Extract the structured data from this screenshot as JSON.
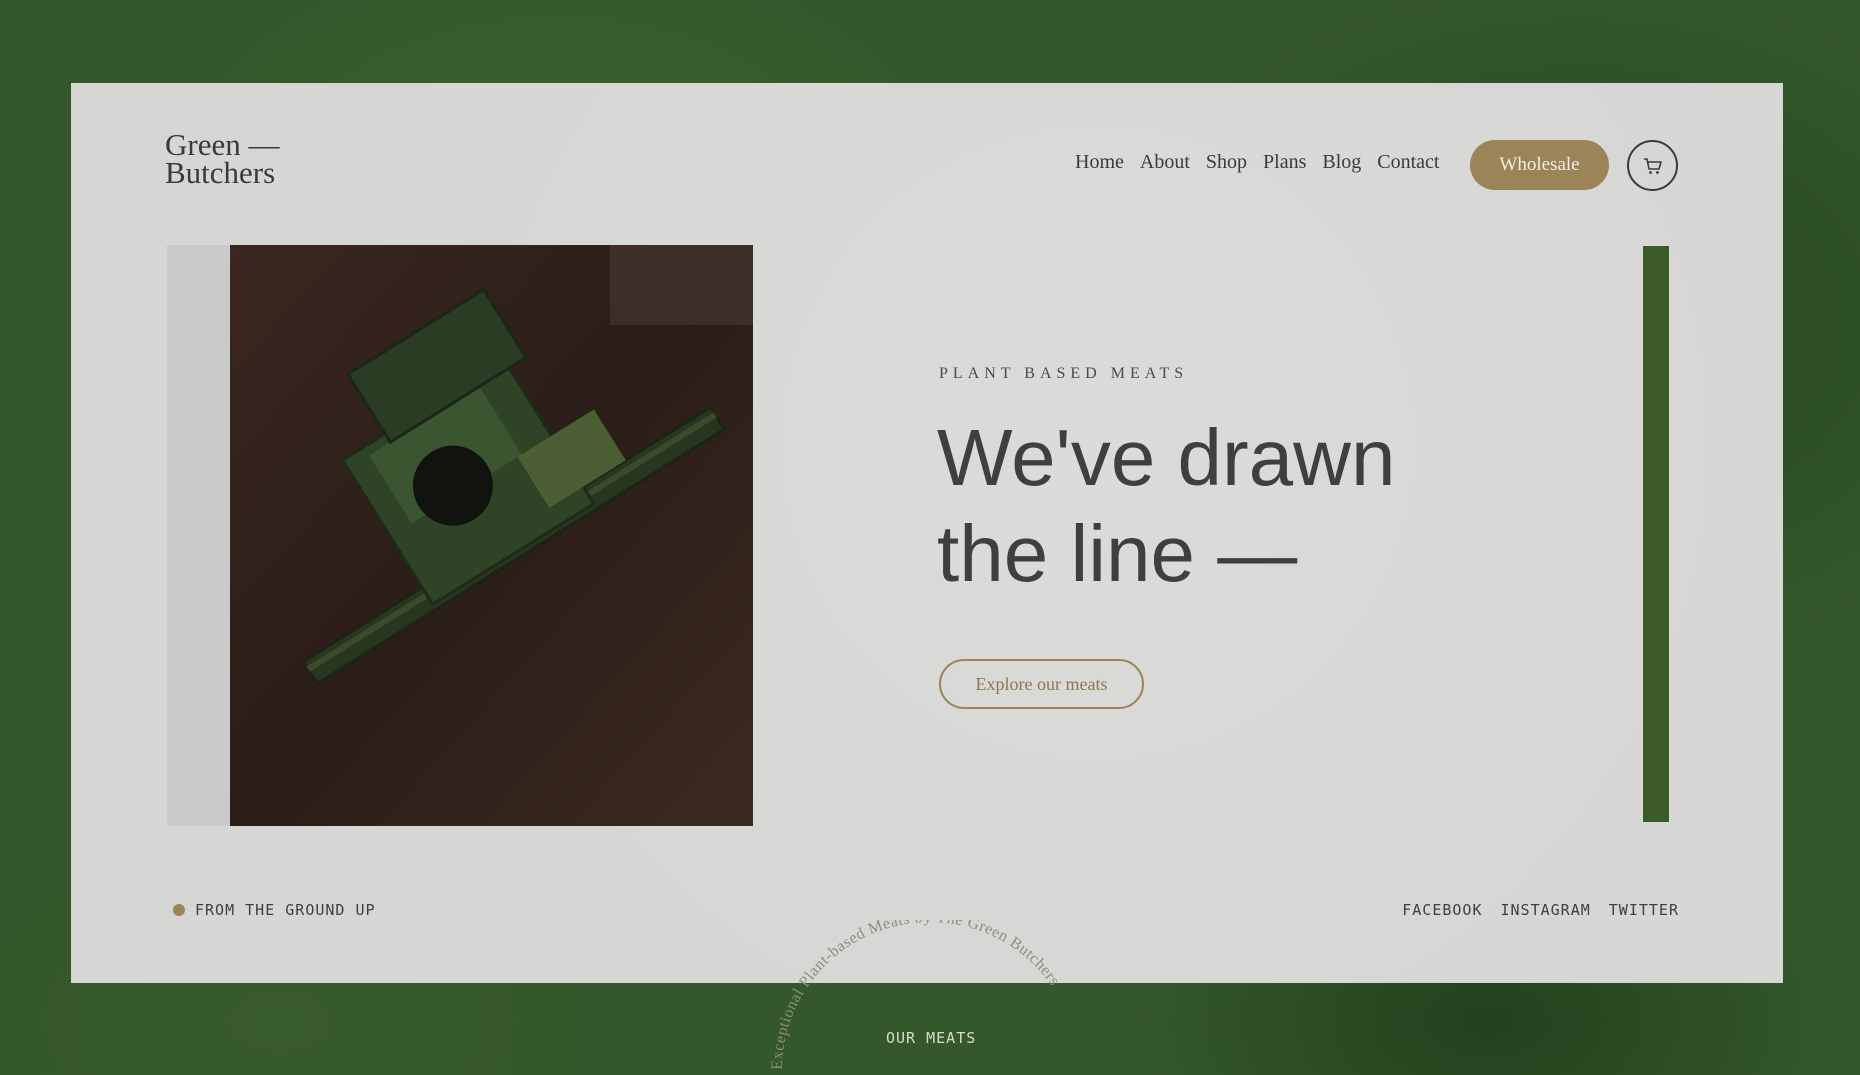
{
  "brand": {
    "line1": "Green —",
    "line2": "Butchers"
  },
  "nav": {
    "items": [
      {
        "label": "Home"
      },
      {
        "label": "About"
      },
      {
        "label": "Shop"
      },
      {
        "label": "Plans"
      },
      {
        "label": "Blog"
      },
      {
        "label": "Contact"
      }
    ],
    "wholesale_label": "Wholesale",
    "cart_icon": "cart-icon"
  },
  "hero": {
    "eyebrow": "PLANT BASED MEATS",
    "headline_line1": "We've drawn",
    "headline_line2": "the line —",
    "cta_label": "Explore our meats",
    "image_description_icon": "harvester-image"
  },
  "footer": {
    "tagline": "FROM THE GROUND UP",
    "socials": [
      {
        "label": "FACEBOOK"
      },
      {
        "label": "INSTAGRAM"
      },
      {
        "label": "TWITTER"
      }
    ],
    "circle_text": "Exceptional Plant-based Meats by The Green Butchers",
    "our_meats": "OUR MEATS"
  },
  "colors": {
    "background_green": "#34572b",
    "card": "#d6d6d4",
    "accent_gold": "#9b8457",
    "bar_green": "#3d5a2b",
    "text_dark": "#3f3f3d"
  }
}
